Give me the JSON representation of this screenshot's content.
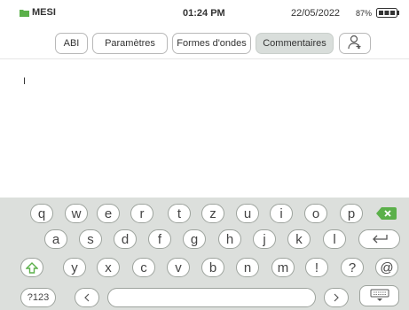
{
  "status": {
    "brand": "MESI",
    "time": "01:24 PM",
    "date": "22/05/2022",
    "battery": "87%",
    "brand_color": "#5bb04a"
  },
  "tabs": [
    {
      "label": "ABI",
      "active": false
    },
    {
      "label": "Paramètres",
      "active": false
    },
    {
      "label": "Formes d'ondes",
      "active": false
    },
    {
      "label": "Commentaires",
      "active": true
    }
  ],
  "editor": {
    "value": "I"
  },
  "keyboard": {
    "row1": [
      "q",
      "w",
      "e",
      "r",
      "t",
      "z",
      "u",
      "i",
      "o",
      "p"
    ],
    "row2": [
      "a",
      "s",
      "d",
      "f",
      "g",
      "h",
      "j",
      "k",
      "l"
    ],
    "row3": [
      "y",
      "x",
      "c",
      "v",
      "b",
      "n",
      "m",
      "!",
      "?",
      "@"
    ],
    "numbers_label": "?123",
    "icons": {
      "backspace": "backspace-icon",
      "enter": "enter-icon",
      "shift": "shift-icon",
      "left": "chevron-left-icon",
      "right": "chevron-right-icon",
      "hide": "keyboard-hide-icon",
      "add_user": "add-user-icon"
    }
  }
}
